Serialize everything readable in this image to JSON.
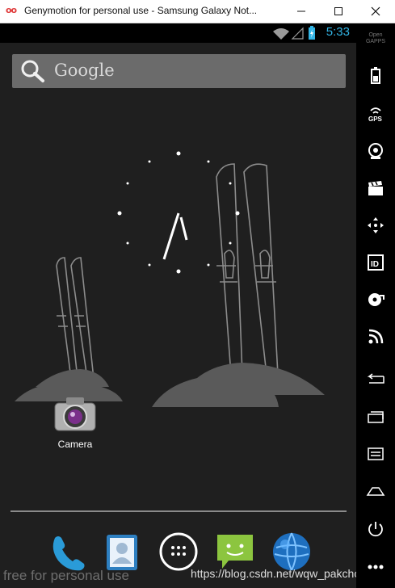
{
  "window": {
    "title": "Genymotion for personal use - Samsung Galaxy Not...",
    "app_icon": "oo"
  },
  "statusbar": {
    "time": "5:33"
  },
  "search": {
    "placeholder": "Google"
  },
  "apps": {
    "camera_label": "Camera"
  },
  "sidebar": {
    "brand": "Open GAPPS"
  },
  "watermarks": {
    "left": "free for personal use",
    "right": "https://blog.csdn.net/wqw_pakchoi"
  },
  "colors": {
    "accent": "#33b5e5",
    "background": "#1f1f1f",
    "sidebar": "#000000"
  }
}
